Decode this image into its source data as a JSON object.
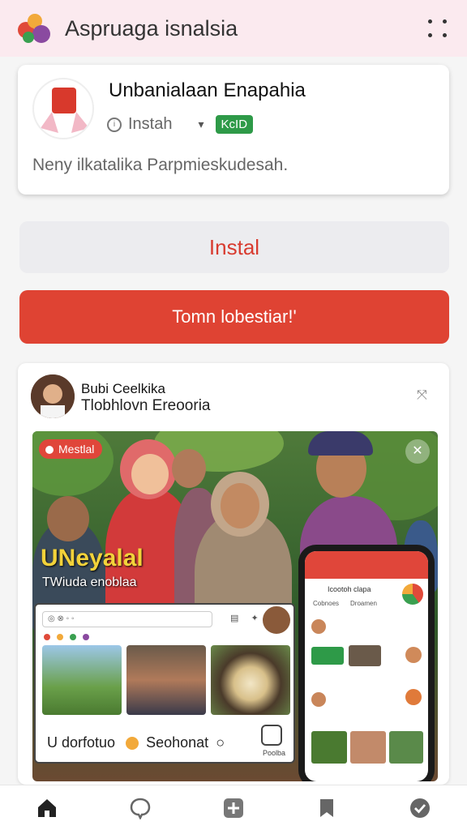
{
  "header": {
    "title": "Aspruaga isnalsia",
    "menu_icon": "more-dots-icon"
  },
  "app": {
    "name": "Unbanialaan Enapahia",
    "source_label": "Instah",
    "badge": "KcID",
    "description": "Neny ilkatalika Parpmieskudesah."
  },
  "actions": {
    "install_label": "Instal",
    "primary_label": "Tomn lobestiar!'"
  },
  "post": {
    "author": "Bubi Ceelkika",
    "subtitle": "Tlobhlovn Ereooria",
    "image_tag": "Mestlal",
    "overlay_title": "UNeyalal",
    "overlay_sub": "TWiuda enoblaa",
    "mock_footer": "U dorfotuo",
    "mock_footer_2": "Seohonat",
    "mock_footer_label": "Poolba",
    "phone_title": "Icootoh clapa",
    "phone_tab_1": "Cobnoes",
    "phone_tab_2": "Droamen"
  },
  "colors": {
    "accent": "#df4333",
    "badge": "#2e9a48",
    "header_bg": "#fbeaef"
  },
  "nav": [
    {
      "icon": "home-icon"
    },
    {
      "icon": "chat-bubble-icon"
    },
    {
      "icon": "add-icon"
    },
    {
      "icon": "bookmark-icon"
    },
    {
      "icon": "check-circle-icon"
    }
  ]
}
